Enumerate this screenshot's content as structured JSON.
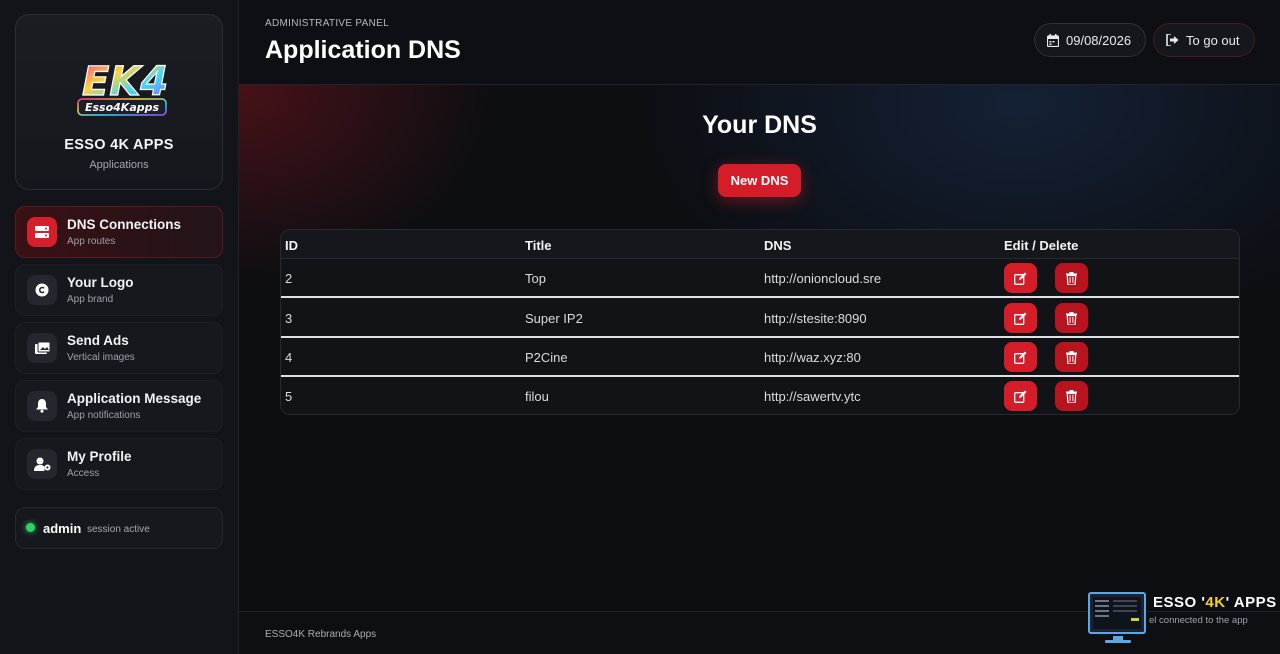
{
  "brand": {
    "logo_text": "EK4",
    "logo_subtext": "Esso4Kapps",
    "name": "ESSO 4K APPS",
    "subtitle": "Applications"
  },
  "sidebar": {
    "items": [
      {
        "title": "DNS Connections",
        "subtitle": "App routes",
        "icon": "server-icon",
        "active": true
      },
      {
        "title": "Your Logo",
        "subtitle": "App brand",
        "icon": "copyright-icon",
        "active": false
      },
      {
        "title": "Send Ads",
        "subtitle": "Vertical images",
        "icon": "images-icon",
        "active": false
      },
      {
        "title": "Application Message",
        "subtitle": "App notifications",
        "icon": "bell-icon",
        "active": false
      },
      {
        "title": "My Profile",
        "subtitle": "Access",
        "icon": "user-gear-icon",
        "active": false
      }
    ],
    "session": {
      "user": "admin",
      "status": "session active"
    }
  },
  "header": {
    "eyebrow": "ADMINISTRATIVE PANEL",
    "title": "Application DNS",
    "date": "09/08/2026",
    "logout_label": "To go out"
  },
  "main": {
    "section_title": "Your DNS",
    "new_button_label": "New DNS",
    "table": {
      "headers": [
        "ID",
        "Title",
        "DNS",
        "Edit / Delete"
      ],
      "rows": [
        {
          "id": "2",
          "title": "Top",
          "dns": "http://onioncloud.sre"
        },
        {
          "id": "3",
          "title": "Super IP2",
          "dns": "http://stesite:8090"
        },
        {
          "id": "4",
          "title": "P2Cine",
          "dns": "http://waz.xyz:80"
        },
        {
          "id": "5",
          "title": "filou",
          "dns": "http://sawertv.ytc"
        }
      ]
    }
  },
  "footer": {
    "text": "ESSO4K Rebrands Apps",
    "promo_title_a": "ESSO '",
    "promo_title_b": "4K",
    "promo_title_c": "' APPS",
    "promo_sub": "el connected to the app"
  },
  "colors": {
    "accent": "#d51d2a",
    "background": "#0c0e12",
    "online": "#2fd167"
  }
}
